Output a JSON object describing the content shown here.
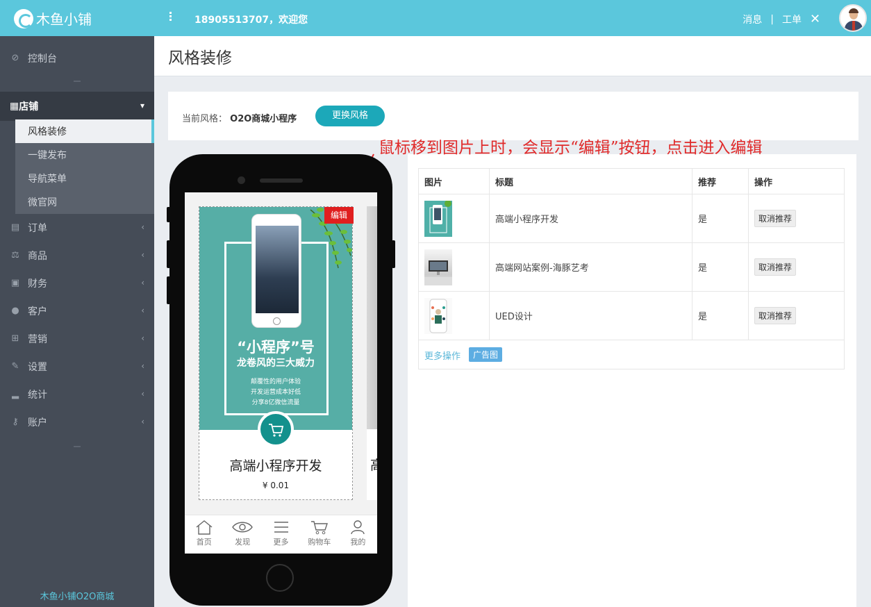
{
  "header": {
    "brand": "木鱼小铺",
    "welcome": "18905513707，欢迎您",
    "links": [
      "消息",
      "工单"
    ],
    "separator": "|",
    "tool_icon": "wrench-icon"
  },
  "sidebar": {
    "dashboard": "控制台",
    "shop": "店铺",
    "shop_subitems": [
      "风格装修",
      "一键发布",
      "导航菜单",
      "微官网"
    ],
    "items": [
      "订单",
      "商品",
      "财务",
      "客户",
      "营销",
      "设置",
      "统计",
      "账户"
    ],
    "footer": "木鱼小铺O2O商城"
  },
  "page": {
    "title": "风格装修",
    "current_style_label": "当前风格：",
    "current_style_name": "O2O商城小程序",
    "change_button": "更换风格",
    "annotation": "鼠标移到图片上时，会显示“编辑”按钮，点击进入编辑"
  },
  "preview": {
    "edit_badge": "编辑",
    "banner_title": "“小程序”号",
    "banner_subtitle": "龙卷风的三大威力",
    "banner_lines": [
      "颠覆性的用户体验",
      "开发运营成本好低",
      "分享8亿微信流量"
    ],
    "product_name": "高端小程序开发",
    "product_price": "¥ 0.01",
    "next_product_initial": "高",
    "tabs": [
      "首页",
      "发现",
      "更多",
      "购物车",
      "我的"
    ]
  },
  "table": {
    "headers": [
      "图片",
      "标题",
      "推荐",
      "操作"
    ],
    "rows": [
      {
        "title": "高端小程序开发",
        "recommend": "是",
        "action": "取消推荐"
      },
      {
        "title": "高端网站案例-海豚艺考",
        "recommend": "是",
        "action": "取消推荐"
      },
      {
        "title": "UED设计",
        "recommend": "是",
        "action": "取消推荐"
      }
    ],
    "more_ops": "更多操作",
    "ad_tag": "广告图"
  },
  "colors": {
    "accent": "#5bc7dc",
    "button": "#1ca8b9",
    "edit": "#e01f1f",
    "annotation": "#e02a2a",
    "sidebar": "#454c57"
  }
}
